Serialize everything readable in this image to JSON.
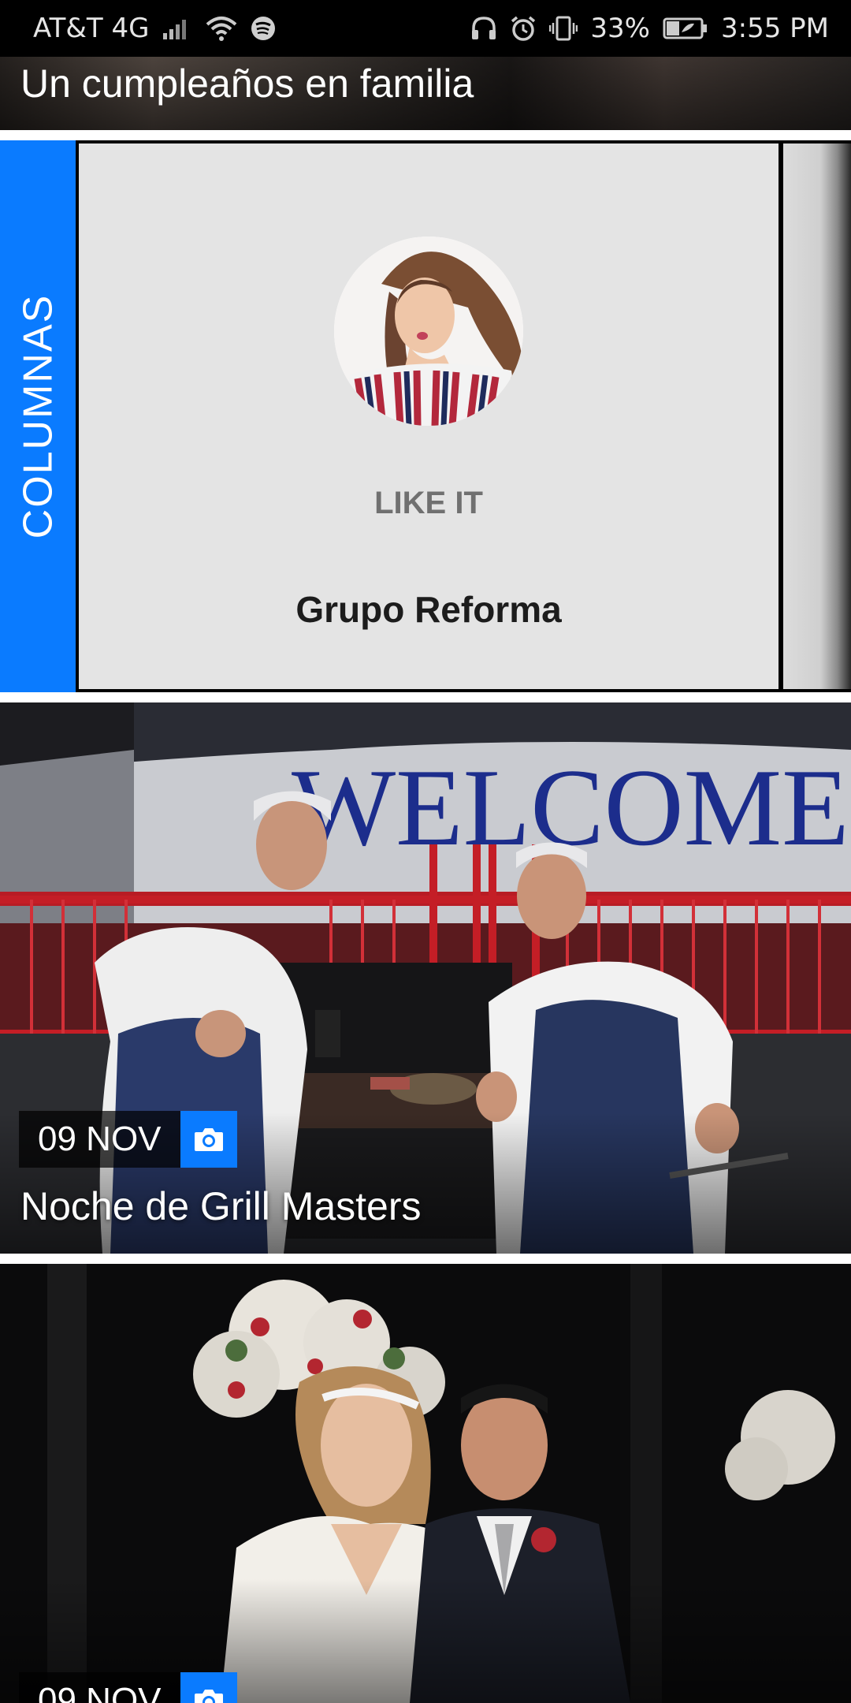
{
  "status_bar": {
    "carrier": "AT&T 4G",
    "battery_percent": "33%",
    "time": "3:55 PM",
    "icons": [
      "signal-icon",
      "wifi-icon",
      "spotify-icon",
      "headphones-icon",
      "alarm-icon",
      "vibrate-icon",
      "battery-icon"
    ]
  },
  "top_card": {
    "title": "Un cumpleaños en familia"
  },
  "columnas": {
    "section_label": "COLUMNAS",
    "column_name": "LIKE IT",
    "author": "Grupo Reforma",
    "accent_color": "#0a7bff"
  },
  "photo_cards": [
    {
      "date": "09 NOV",
      "title": "Noche de Grill Masters",
      "icon": "camera-icon",
      "scene_text": "WELCOME"
    },
    {
      "date": "09 NOV",
      "title": "",
      "icon": "camera-icon"
    }
  ]
}
